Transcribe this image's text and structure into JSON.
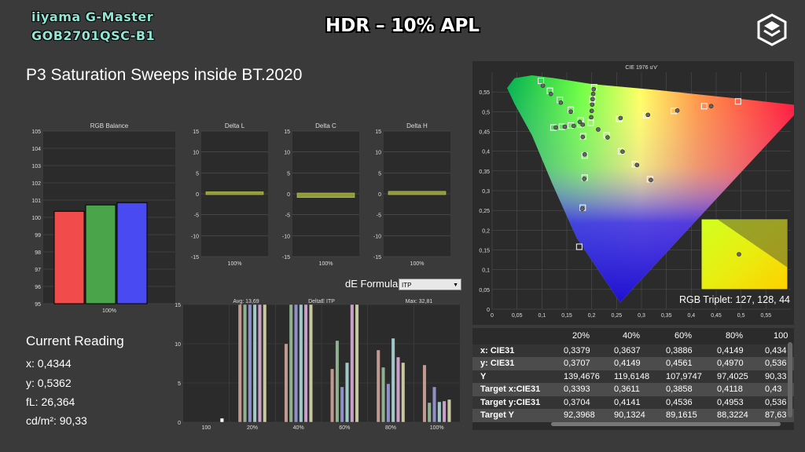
{
  "header": {
    "brand_line1": "iiyama G-Master",
    "brand_line2": "GOB2701QSC-B1",
    "title": "HDR – 10% APL",
    "logo_icon": "hexagon-logo-icon"
  },
  "sweep_title": "P3 Saturation Sweeps inside BT.2020",
  "current_reading": {
    "title": "Current Reading",
    "x": "x: 0,4344",
    "y": "y: 0,5362",
    "fl": "fL: 26,364",
    "cdm2": "cd/m²: 90,33"
  },
  "de_formula": {
    "label": "dE Formula:",
    "value": "ITP"
  },
  "chart_data": [
    {
      "type": "bar",
      "title": "RGB Balance",
      "categories": [
        "100%"
      ],
      "series": [
        {
          "name": "R",
          "values": [
            100.35
          ],
          "color": "#f24b4b"
        },
        {
          "name": "G",
          "values": [
            100.72
          ],
          "color": "#4aa44a"
        },
        {
          "name": "B",
          "values": [
            100.85
          ],
          "color": "#4a4af2"
        }
      ],
      "ylim": [
        95,
        105
      ],
      "yticks": [
        "95",
        "96",
        "97",
        "98",
        "99",
        "100",
        "101",
        "102",
        "103",
        "104",
        "105"
      ],
      "grid": true
    },
    {
      "type": "bar",
      "title": "Delta L",
      "categories": [
        "100%"
      ],
      "values": [
        0.3
      ],
      "ylim": [
        -15,
        15
      ],
      "yticks": [
        "-15",
        "-10",
        "-5",
        "0",
        "5",
        "10",
        "15"
      ]
    },
    {
      "type": "bar",
      "title": "Delta C",
      "categories": [
        "100%"
      ],
      "values": [
        -0.7
      ],
      "ylim": [
        -15,
        15
      ],
      "yticks": [
        "-15",
        "-10",
        "-5",
        "0",
        "5",
        "10",
        "15"
      ]
    },
    {
      "type": "bar",
      "title": "Delta H",
      "categories": [
        "100%"
      ],
      "values": [
        0.4
      ],
      "ylim": [
        -15,
        15
      ],
      "yticks": [
        "-15",
        "-10",
        "-5",
        "0",
        "5",
        "10",
        "15"
      ]
    },
    {
      "type": "bar",
      "title": "DeltaE ITP",
      "avg_label": "Avg: 13,69",
      "max_label": "Max: 32,81",
      "categories": [
        "100",
        "20%",
        "40%",
        "60%",
        "80%",
        "100%"
      ],
      "ylim": [
        0,
        15
      ],
      "yticks": [
        "0",
        "5",
        "10",
        "15"
      ],
      "series": [
        {
          "name": "White",
          "color": "#ffffff",
          "values": [
            0.5,
            null,
            null,
            null,
            null,
            null
          ]
        },
        {
          "name": "Red",
          "color": "#c09a90",
          "values": [
            null,
            15,
            10,
            6.8,
            9.2,
            7.3
          ]
        },
        {
          "name": "Green",
          "color": "#90b090",
          "values": [
            null,
            15,
            15,
            10.4,
            7.0,
            2.5
          ]
        },
        {
          "name": "Blue",
          "color": "#9090c8",
          "values": [
            null,
            15,
            15,
            4.5,
            4.9,
            4.5
          ]
        },
        {
          "name": "Cyan",
          "color": "#a0c8c8",
          "values": [
            null,
            15,
            15,
            7.6,
            10.7,
            2.6
          ]
        },
        {
          "name": "Magenta",
          "color": "#c8a0c8",
          "values": [
            null,
            15,
            15,
            15,
            8.3,
            2.7
          ]
        },
        {
          "name": "Yellow",
          "color": "#c8c8a0",
          "values": [
            null,
            15,
            15,
            15,
            7.6,
            2.9
          ]
        }
      ],
      "bar_colors": [
        "#ffffff",
        "#c09a90",
        "#90b090",
        "#9090c8",
        "#a0c8c8",
        "#c8a0c8",
        "#c8c8a0"
      ]
    },
    {
      "type": "scatter",
      "title": "CIE 1976 u'v'",
      "xticks": [
        "0",
        "0,05",
        "0,1",
        "0,15",
        "0,2",
        "0,25",
        "0,3",
        "0,35",
        "0,4",
        "0,45",
        "0,5",
        "0,55"
      ],
      "yticks": [
        "0",
        "0,05",
        "0,1",
        "0,15",
        "0,2",
        "0,25",
        "0,3",
        "0,35",
        "0,4",
        "0,45",
        "0,5",
        "0,55"
      ],
      "xlim": [
        0,
        0.6
      ],
      "ylim": [
        0,
        0.6
      ],
      "targets": [
        [
          0.098,
          0.578
        ],
        [
          0.116,
          0.553
        ],
        [
          0.136,
          0.53
        ],
        [
          0.158,
          0.505
        ],
        [
          0.178,
          0.478
        ],
        [
          0.183,
          0.438
        ],
        [
          0.186,
          0.389
        ],
        [
          0.186,
          0.333
        ],
        [
          0.182,
          0.257
        ],
        [
          0.175,
          0.158
        ],
        [
          0.205,
          0.562
        ],
        [
          0.201,
          0.531
        ],
        [
          0.198,
          0.472
        ],
        [
          0.255,
          0.482
        ],
        [
          0.309,
          0.491
        ],
        [
          0.365,
          0.502
        ],
        [
          0.426,
          0.514
        ],
        [
          0.494,
          0.526
        ],
        [
          0.23,
          0.44
        ],
        [
          0.259,
          0.4
        ],
        [
          0.287,
          0.367
        ],
        [
          0.317,
          0.329
        ],
        [
          0.123,
          0.46
        ],
        [
          0.14,
          0.462
        ],
        [
          0.158,
          0.465
        ],
        [
          0.178,
          0.468
        ]
      ],
      "measured": [
        [
          0.102,
          0.566
        ],
        [
          0.118,
          0.545
        ],
        [
          0.138,
          0.523
        ],
        [
          0.158,
          0.5
        ],
        [
          0.176,
          0.474
        ],
        [
          0.182,
          0.436
        ],
        [
          0.186,
          0.392
        ],
        [
          0.185,
          0.33
        ],
        [
          0.181,
          0.254
        ],
        [
          0.204,
          0.557
        ],
        [
          0.203,
          0.545
        ],
        [
          0.202,
          0.532
        ],
        [
          0.201,
          0.518
        ],
        [
          0.2,
          0.502
        ],
        [
          0.199,
          0.486
        ],
        [
          0.258,
          0.484
        ],
        [
          0.313,
          0.492
        ],
        [
          0.372,
          0.503
        ],
        [
          0.44,
          0.514
        ],
        [
          0.213,
          0.455
        ],
        [
          0.232,
          0.435
        ],
        [
          0.262,
          0.399
        ],
        [
          0.291,
          0.365
        ],
        [
          0.319,
          0.327
        ],
        [
          0.128,
          0.46
        ],
        [
          0.146,
          0.462
        ],
        [
          0.164,
          0.464
        ],
        [
          0.182,
          0.467
        ]
      ],
      "inset_label": "RGB Triplet: 127, 128, 44"
    }
  ],
  "table": {
    "columns": [
      "",
      "20%",
      "40%",
      "60%",
      "80%",
      "100"
    ],
    "rows": [
      {
        "label": "x: CIE31",
        "values": [
          "0,3379",
          "0,3637",
          "0,3886",
          "0,4149",
          "0,434"
        ]
      },
      {
        "label": "y: CIE31",
        "values": [
          "0,3707",
          "0,4149",
          "0,4561",
          "0,4970",
          "0,536"
        ]
      },
      {
        "label": "Y",
        "values": [
          "139,4676",
          "119,6148",
          "107,9747",
          "97,4025",
          "90,33"
        ]
      },
      {
        "label": "Target x:CIE31",
        "values": [
          "0,3393",
          "0,3611",
          "0,3858",
          "0,4118",
          "0,43"
        ]
      },
      {
        "label": "Target y:CIE31",
        "values": [
          "0,3704",
          "0,4141",
          "0,4536",
          "0,4953",
          "0,536"
        ]
      },
      {
        "label": "Target Y",
        "values": [
          "92,3968",
          "90,1324",
          "89,1615",
          "88,3224",
          "87,63"
        ]
      }
    ]
  }
}
